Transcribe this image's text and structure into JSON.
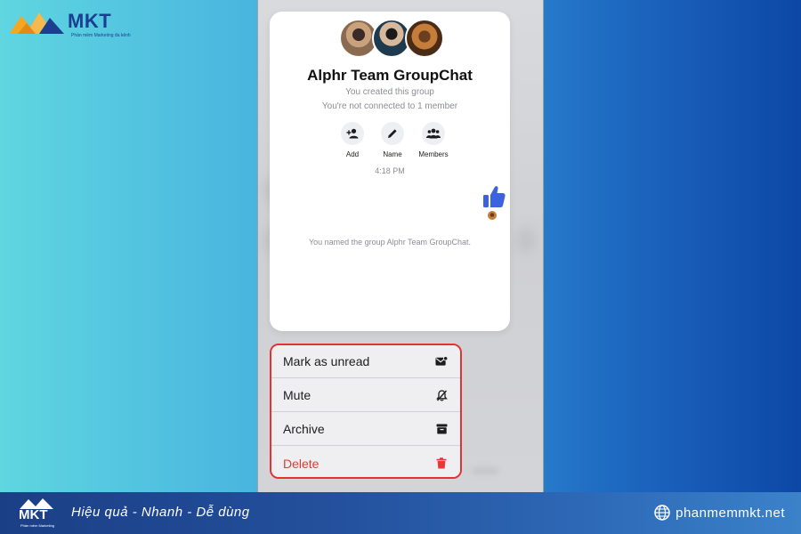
{
  "brand": {
    "name": "MKT",
    "tagline": "Phần mềm Marketing đa kênh",
    "colors": {
      "primary": "#1a3f91",
      "accent": "#f5a623"
    }
  },
  "preview": {
    "group_title": "Alphr Team GroupChat",
    "created_note": "You created this group",
    "connection_note": "You're not connected to 1 member",
    "actions": [
      {
        "label": "Add",
        "icon": "add-person-icon"
      },
      {
        "label": "Name",
        "icon": "pencil-icon"
      },
      {
        "label": "Members",
        "icon": "group-icon"
      }
    ],
    "time": "4:18 PM",
    "like_icon": "thumbs-up-icon",
    "system_message": "You named the group Alphr Team GroupChat."
  },
  "menu": {
    "highlight_color": "#e23232",
    "items": [
      {
        "label": "Mark as unread",
        "icon": "mark-unread-icon"
      },
      {
        "label": "Mute",
        "icon": "bell-slash-icon"
      },
      {
        "label": "Archive",
        "icon": "archive-box-icon"
      },
      {
        "label": "Delete",
        "icon": "trash-icon",
        "color": "#e53935"
      }
    ]
  },
  "footer": {
    "logo_name": "MKT",
    "logo_sub": "Phần mềm Marketing",
    "slogan": "Hiệu quả - Nhanh  - Dễ dùng",
    "website": "phanmemmkt.net"
  }
}
